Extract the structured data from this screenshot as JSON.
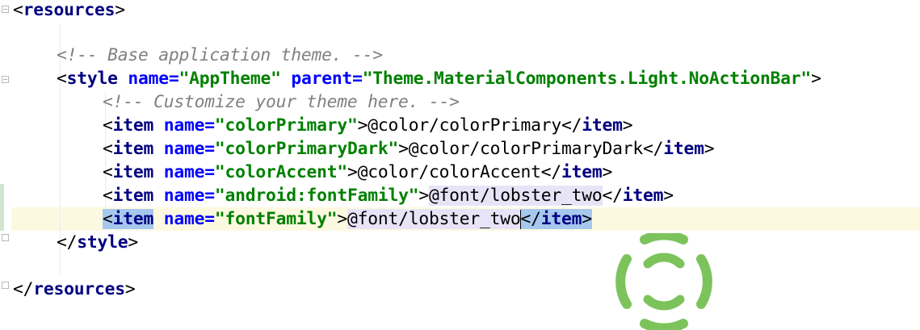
{
  "editor": {
    "lines": [
      {
        "id": "resources-open",
        "tokens": [
          {
            "t": "<",
            "c": "punct"
          },
          {
            "t": "resources",
            "c": "tag"
          },
          {
            "t": ">",
            "c": "punct"
          }
        ]
      },
      {
        "id": "comment-base",
        "tokens": [
          {
            "t": "<!-- Base application theme. -->",
            "c": "comment"
          }
        ]
      },
      {
        "id": "style-open",
        "tokens": [
          {
            "t": "<",
            "c": "punct"
          },
          {
            "t": "style",
            "c": "tag"
          },
          {
            "t": " ",
            "c": "txt"
          },
          {
            "t": "name",
            "c": "attr"
          },
          {
            "t": "=",
            "c": "attr"
          },
          {
            "t": "\"AppTheme\"",
            "c": "val"
          },
          {
            "t": " ",
            "c": "txt"
          },
          {
            "t": "parent",
            "c": "attr"
          },
          {
            "t": "=",
            "c": "attr"
          },
          {
            "t": "\"Theme.MaterialComponents.Light.NoActionBar\"",
            "c": "val"
          },
          {
            "t": ">",
            "c": "punct"
          }
        ]
      },
      {
        "id": "comment-customize",
        "tokens": [
          {
            "t": "<!-- Customize your theme here. -->",
            "c": "comment"
          }
        ]
      },
      {
        "id": "item-color-primary",
        "tokens": [
          {
            "t": "<",
            "c": "punct"
          },
          {
            "t": "item",
            "c": "tag"
          },
          {
            "t": " ",
            "c": "txt"
          },
          {
            "t": "name",
            "c": "attr"
          },
          {
            "t": "=",
            "c": "attr"
          },
          {
            "t": "\"colorPrimary\"",
            "c": "val"
          },
          {
            "t": ">",
            "c": "punct"
          },
          {
            "t": "@color/colorPrimary",
            "c": "txt"
          },
          {
            "t": "</",
            "c": "punct"
          },
          {
            "t": "item",
            "c": "tag"
          },
          {
            "t": ">",
            "c": "punct"
          }
        ]
      },
      {
        "id": "item-color-primary-dark",
        "tokens": [
          {
            "t": "<",
            "c": "punct"
          },
          {
            "t": "item",
            "c": "tag"
          },
          {
            "t": " ",
            "c": "txt"
          },
          {
            "t": "name",
            "c": "attr"
          },
          {
            "t": "=",
            "c": "attr"
          },
          {
            "t": "\"colorPrimaryDark\"",
            "c": "val"
          },
          {
            "t": ">",
            "c": "punct"
          },
          {
            "t": "@color/colorPrimaryDark",
            "c": "txt"
          },
          {
            "t": "</",
            "c": "punct"
          },
          {
            "t": "item",
            "c": "tag"
          },
          {
            "t": ">",
            "c": "punct"
          }
        ]
      },
      {
        "id": "item-color-accent",
        "tokens": [
          {
            "t": "<",
            "c": "punct"
          },
          {
            "t": "item",
            "c": "tag"
          },
          {
            "t": " ",
            "c": "txt"
          },
          {
            "t": "name",
            "c": "attr"
          },
          {
            "t": "=",
            "c": "attr"
          },
          {
            "t": "\"colorAccent\"",
            "c": "val"
          },
          {
            "t": ">",
            "c": "punct"
          },
          {
            "t": "@color/colorAccent",
            "c": "txt"
          },
          {
            "t": "</",
            "c": "punct"
          },
          {
            "t": "item",
            "c": "tag"
          },
          {
            "t": ">",
            "c": "punct"
          }
        ]
      },
      {
        "id": "item-android-font-family",
        "tokens": [
          {
            "t": "<",
            "c": "punct"
          },
          {
            "t": "item",
            "c": "tag"
          },
          {
            "t": " ",
            "c": "txt"
          },
          {
            "t": "name",
            "c": "attr"
          },
          {
            "t": "=",
            "c": "attr"
          },
          {
            "t": "\"android:fontFamily\"",
            "c": "val"
          },
          {
            "t": ">",
            "c": "punct"
          },
          {
            "t": "@font/lobster_two",
            "c": "txt",
            "hl": "text"
          },
          {
            "t": "</",
            "c": "punct"
          },
          {
            "t": "item",
            "c": "tag"
          },
          {
            "t": ">",
            "c": "punct"
          }
        ]
      },
      {
        "id": "item-font-family",
        "tokens": [
          {
            "t": "<",
            "c": "punct",
            "hl": "tag"
          },
          {
            "t": "item",
            "c": "tag",
            "hl": "tag"
          },
          {
            "t": " ",
            "c": "txt"
          },
          {
            "t": "name",
            "c": "attr"
          },
          {
            "t": "=",
            "c": "attr"
          },
          {
            "t": "\"fontFamily\"",
            "c": "val"
          },
          {
            "t": ">",
            "c": "punct"
          },
          {
            "t": "@font/lobster_two",
            "c": "txt",
            "hl": "text"
          },
          {
            "caret": true
          },
          {
            "t": "</",
            "c": "punct",
            "hl": "tag"
          },
          {
            "t": "item",
            "c": "tag",
            "hl": "tag"
          },
          {
            "t": ">",
            "c": "punct",
            "hl": "tag"
          }
        ]
      },
      {
        "id": "style-close",
        "tokens": [
          {
            "t": "</",
            "c": "punct"
          },
          {
            "t": "style",
            "c": "tag"
          },
          {
            "t": ">",
            "c": "punct"
          }
        ]
      },
      {
        "id": "resources-close",
        "tokens": [
          {
            "t": "</",
            "c": "punct"
          },
          {
            "t": "resources",
            "c": "tag"
          },
          {
            "t": ">",
            "c": "punct"
          }
        ]
      }
    ]
  },
  "spinner": {
    "icon": "loading-spinner-icon",
    "color": "#7cc35c"
  },
  "colors": {
    "tag": "#000080",
    "attr": "#0000ff",
    "value": "#008000",
    "comment": "#808080",
    "current_line": "#fdf9e1",
    "tag_match_highlight": "#a6c8ef",
    "usage_highlight": "#e8e4f7"
  }
}
